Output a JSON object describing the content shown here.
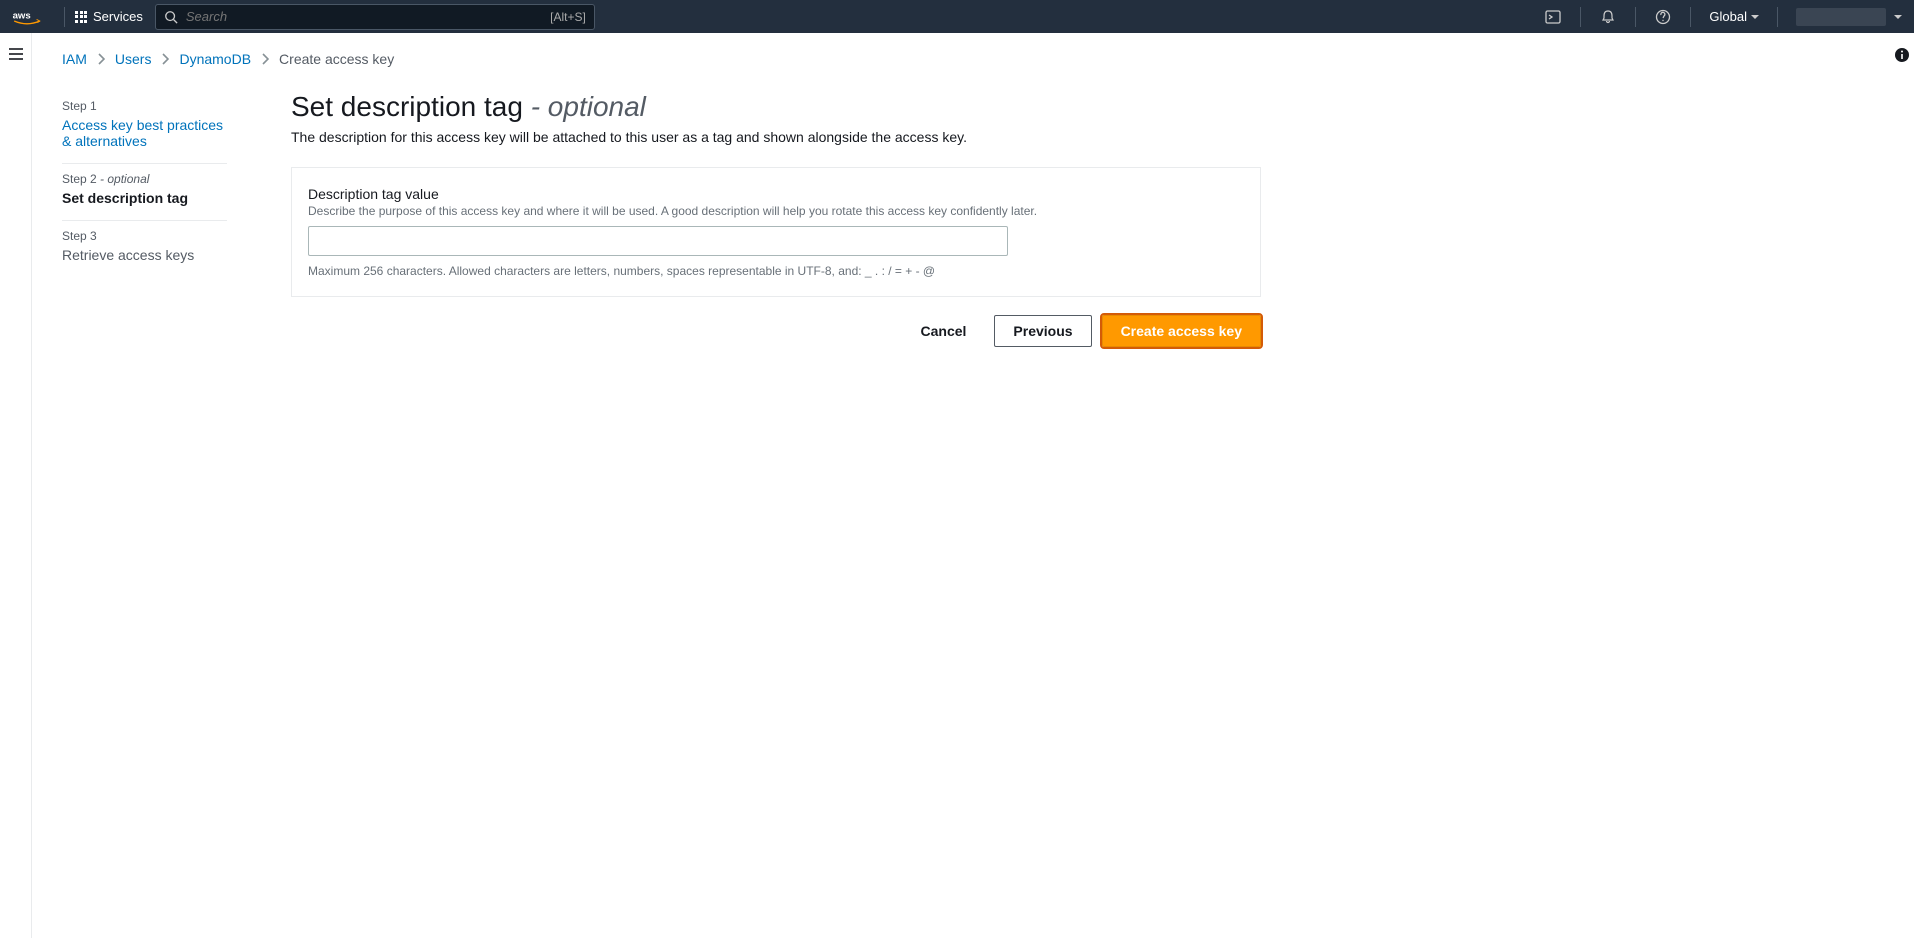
{
  "nav": {
    "services_label": "Services",
    "search_placeholder": "Search",
    "search_kbd": "[Alt+S]",
    "region": "Global"
  },
  "breadcrumb": {
    "iam": "IAM",
    "users": "Users",
    "user": "DynamoDB",
    "current": "Create access key"
  },
  "steps": {
    "s1_num": "Step 1",
    "s1_title": "Access key best practices & alternatives",
    "s2_num": "Step 2",
    "s2_opt": " - optional",
    "s2_title": "Set description tag",
    "s3_num": "Step 3",
    "s3_title": "Retrieve access keys"
  },
  "page": {
    "title_main": "Set description tag ",
    "title_opt": "- optional",
    "subtitle": "The description for this access key will be attached to this user as a tag and shown alongside the access key."
  },
  "form": {
    "label": "Description tag value",
    "desc": "Describe the purpose of this access key and where it will be used. A good description will help you rotate this access key confidently later.",
    "value": "",
    "hint": "Maximum 256 characters. Allowed characters are letters, numbers, spaces representable in UTF-8, and: _ . : / = + - @"
  },
  "actions": {
    "cancel": "Cancel",
    "previous": "Previous",
    "create": "Create access key"
  }
}
